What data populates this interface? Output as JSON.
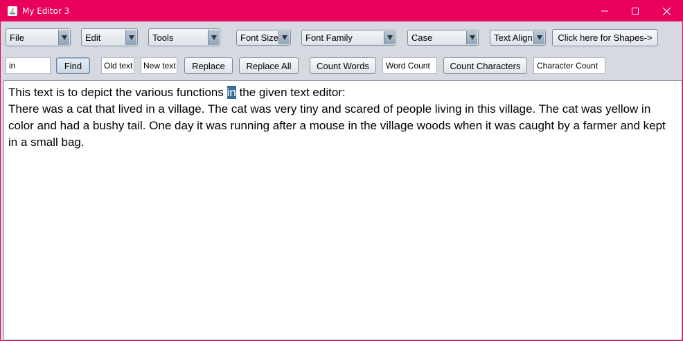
{
  "window": {
    "title": "My Editor 3",
    "accent_color": "#e8005c",
    "controls": [
      "minimize-icon",
      "maximize-icon",
      "close-icon"
    ]
  },
  "toolbar_row1": {
    "file": "File",
    "edit": "Edit",
    "tools": "Tools",
    "font_size": "Font Size",
    "font_family": "Font Family",
    "case": "Case",
    "text_align": "Text Align",
    "shapes_button": "Click here for Shapes->"
  },
  "toolbar_row2": {
    "find_value": "in",
    "find_button": "Find",
    "old_text": "Old text",
    "new_text": "New text",
    "replace_button": "Replace",
    "replace_all_button": "Replace All",
    "count_words_button": "Count Words",
    "word_count_field": "Word Count",
    "count_characters_button": "Count Characters",
    "character_count_field": "Character Count"
  },
  "editor": {
    "line1_before": "This text is to depict the various functions ",
    "line1_highlight": "in",
    "line1_after": " the given text editor:",
    "paragraph2": "There was a cat that lived in a village. The cat was very tiny and scared of people living in this village. The cat was yellow in color and had a bushy tail. One day it was running after a mouse in the village woods when it was caught by a farmer and kept in a small bag.",
    "highlight_color": "#3b6e96"
  }
}
